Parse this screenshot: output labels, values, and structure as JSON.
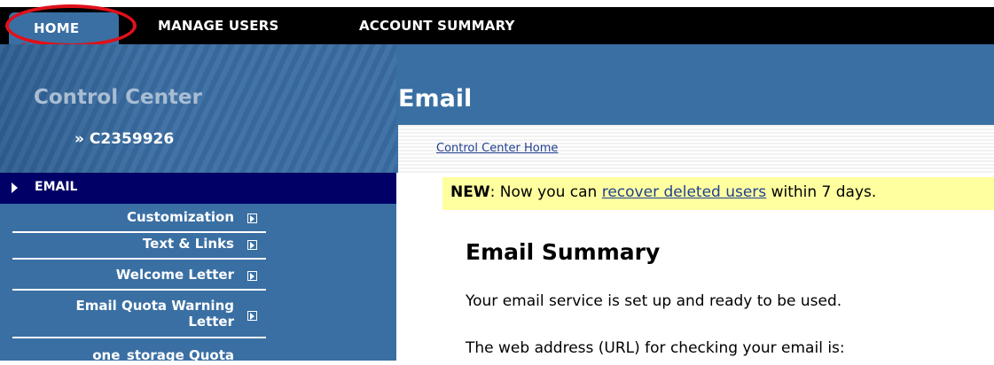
{
  "nav": {
    "tabs": [
      {
        "label": "HOME"
      },
      {
        "label": "MANAGE USERS"
      },
      {
        "label": "ACCOUNT SUMMARY"
      }
    ],
    "active_tab": "HOME"
  },
  "sidebar": {
    "title": "Control Center",
    "account_id": "» C2359926",
    "active_item": "EMAIL",
    "items": [
      {
        "label": "Customization"
      },
      {
        "label": "Text & Links"
      },
      {
        "label": "Welcome Letter"
      },
      {
        "label_line1": "Email Quota Warning",
        "label_line2": "Letter"
      },
      {
        "label": "one_storage Quota"
      }
    ]
  },
  "main": {
    "page_title": "Email",
    "breadcrumb": "Control Center Home",
    "notice": {
      "prefix": "NEW",
      "text_before": ": Now you can ",
      "link": "recover deleted users",
      "text_after": " within 7 days."
    },
    "section_title": "Email Summary",
    "paragraph1": "Your email service is set up and ready to be used.",
    "paragraph2": "The web address (URL) for checking your email is:"
  },
  "colors": {
    "nav_bg": "#000000",
    "header_blue": "#3a6fa3",
    "sidebar_active": "#000066",
    "notice_bg": "#ffffa0",
    "highlight_red": "#e0101a",
    "link": "#1f3f8f"
  }
}
